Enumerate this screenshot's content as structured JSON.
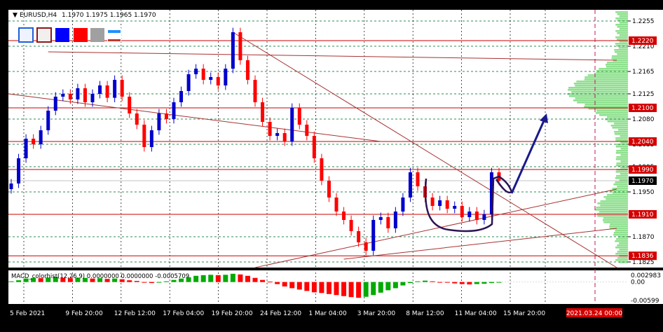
{
  "window_title": "EURUSD,H4  1.1970 1.1975 1.1965 1.1970",
  "header": {
    "symbol_text": "EURUSD,H4",
    "ohlc_text": "1.1970 1.1975 1.1965 1.1970"
  },
  "toolbar": {
    "icons": [
      "outline-square-icon",
      "outline-square-icon",
      "filled-square-icon",
      "filled-square-icon",
      "filled-square-icon",
      "line-style-icon"
    ],
    "colors": [
      "#ffffff",
      "#c0392b",
      "#0000ff",
      "#ff0000",
      "#a0a0a0",
      "#1e90ff"
    ]
  },
  "chart_data": [
    {
      "type": "line",
      "name_on_chart": "EURUSD,H4",
      "title": "",
      "xlabel": "",
      "ylabel": "",
      "ylim": [
        1.1815,
        1.2275
      ],
      "x_tick_labels": [
        "5 Feb 2021",
        "9 Feb 20:00",
        "12 Feb 12:00",
        "17 Feb 04:00",
        "19 Feb 20:00",
        "24 Feb 12:00",
        "1 Mar 04:00",
        "3 Mar 20:00",
        "8 Mar 12:00",
        "11 Mar 04:00",
        "15 Mar 20:00"
      ],
      "y_tick_labels": [
        "1.2255",
        "1.2210",
        "1.2165",
        "1.2125",
        "1.2080",
        "1.2035",
        "1.1995",
        "1.1950",
        "1.1870",
        "1.1825"
      ],
      "price_levels": [
        {
          "label": "1.2220",
          "value": 1.222,
          "color": "#cc0000"
        },
        {
          "label": "1.2100",
          "value": 1.21,
          "color": "#cc0000"
        },
        {
          "label": "1.2040",
          "value": 1.204,
          "color": "#cc0000"
        },
        {
          "label": "1.1990",
          "value": 1.199,
          "color": "#cc0000"
        },
        {
          "label": "1.1970",
          "value": 1.197,
          "color": "#000000"
        },
        {
          "label": "1.1910",
          "value": 1.191,
          "color": "#cc0000"
        },
        {
          "label": "1.1836",
          "value": 1.1836,
          "color": "#cc0000"
        }
      ],
      "series": [
        {
          "values": [
            1.1965,
            1.201,
            1.2045,
            1.2035,
            1.206,
            1.2095,
            1.212,
            1.2125,
            1.2115,
            1.2135,
            1.211,
            1.2125,
            1.214,
            1.2118,
            1.215,
            1.212,
            1.209,
            1.207,
            1.203,
            1.206,
            1.209,
            1.208,
            1.211,
            1.213,
            1.216,
            1.217,
            1.215,
            1.2155,
            1.214,
            1.217,
            1.2235,
            1.2185,
            1.215,
            1.211,
            1.2075,
            1.205,
            1.2055,
            1.204,
            1.21,
            1.207,
            1.205,
            1.201,
            1.197,
            1.194,
            1.1915,
            1.19,
            1.188,
            1.186,
            1.1845,
            1.19,
            1.1905,
            1.1885,
            1.1915,
            1.194,
            1.1985,
            1.196,
            1.194,
            1.1925,
            1.1935,
            1.192,
            1.1925,
            1.1905,
            1.1915,
            1.19,
            1.191,
            1.1985,
            1.197
          ]
        }
      ],
      "trend_lines": [
        {
          "from": [
            5,
            1.22
          ],
          "to": [
            66,
            1.2185
          ]
        },
        {
          "from": [
            30,
            1.2235
          ],
          "to": [
            66,
            1.1815
          ]
        },
        {
          "from": [
            0,
            1.2125
          ],
          "to": [
            50,
            1.204
          ]
        },
        {
          "from": [
            33,
            1.1815
          ],
          "to": [
            66,
            1.1955
          ]
        },
        {
          "from": [
            45,
            1.183
          ],
          "to": [
            66,
            1.1885
          ]
        }
      ],
      "volume_profile": "right-side histogram, green"
    },
    {
      "type": "bar",
      "name": "MACD_colorhist",
      "legend_text": "MACD_colorhist(12,26,9) 0.0000000 0.0000000 -0.0005709",
      "y_tick_labels": [
        "0.002983",
        "0.00",
        "-0.00599"
      ],
      "ylim": [
        -0.00599,
        0.002983
      ],
      "values": [
        0.0002,
        0.0005,
        0.001,
        0.0012,
        0.0011,
        0.0013,
        0.0015,
        0.0012,
        0.0011,
        0.0012,
        0.0012,
        0.001,
        0.0011,
        0.0009,
        0.001,
        0.0008,
        0.0005,
        0.0003,
        -0.0002,
        -0.0003,
        -0.0001,
        0.0002,
        0.0006,
        0.001,
        0.0014,
        0.0018,
        0.002,
        0.0021,
        0.002,
        0.0021,
        0.0024,
        0.0022,
        0.0018,
        0.0012,
        0.0006,
        0.0001,
        -0.0006,
        -0.0013,
        -0.0018,
        -0.0022,
        -0.0026,
        -0.003,
        -0.0032,
        -0.0035,
        -0.0038,
        -0.0041,
        -0.0044,
        -0.0046,
        -0.0043,
        -0.0038,
        -0.0031,
        -0.0024,
        -0.0018,
        -0.001,
        -0.0003,
        0.0002,
        0.0004,
        0.0002,
        0.0,
        -0.0002,
        -0.0004,
        -0.0006,
        -0.0007,
        -0.0006,
        -0.0005,
        -0.0003,
        -0.0002
      ]
    }
  ],
  "time_badge": "2021.03.24 00:00",
  "colors": {
    "background": "#000000",
    "bull": "#0000cc",
    "bear": "#ff0000",
    "level_line": "#cc0000",
    "grid": "#2e8b57",
    "price_badge_bg": "#d40000",
    "macd_up": "#00aa00",
    "macd_down": "#ff0000",
    "annotation": "#1a1a8c"
  }
}
